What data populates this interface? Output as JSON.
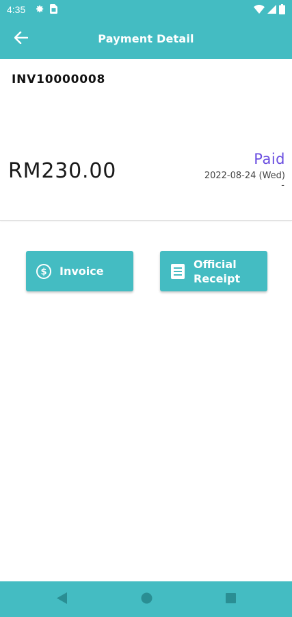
{
  "status_bar": {
    "time": "4:35",
    "left_icons": [
      "gear-icon",
      "sim-card-icon"
    ],
    "right_icons": [
      "wifi-icon",
      "cell-signal-icon",
      "battery-icon"
    ]
  },
  "app_bar": {
    "title": "Payment Detail",
    "back_icon": "arrow-left-icon"
  },
  "payment": {
    "invoice_number": "INV10000008",
    "amount": "RM230.00",
    "status": "Paid",
    "date": "2022-08-24 (Wed)",
    "extra": "-"
  },
  "actions": {
    "invoice_label": "Invoice",
    "invoice_icon": "dollar-circle-icon",
    "receipt_label": "Official Receipt",
    "receipt_icon": "document-icon"
  },
  "nav_bar": {
    "icons": [
      "triangle-back-icon",
      "circle-home-icon",
      "square-recents-icon"
    ]
  },
  "colors": {
    "primary": "#44bcc2",
    "status_paid": "#6a4ee0"
  }
}
